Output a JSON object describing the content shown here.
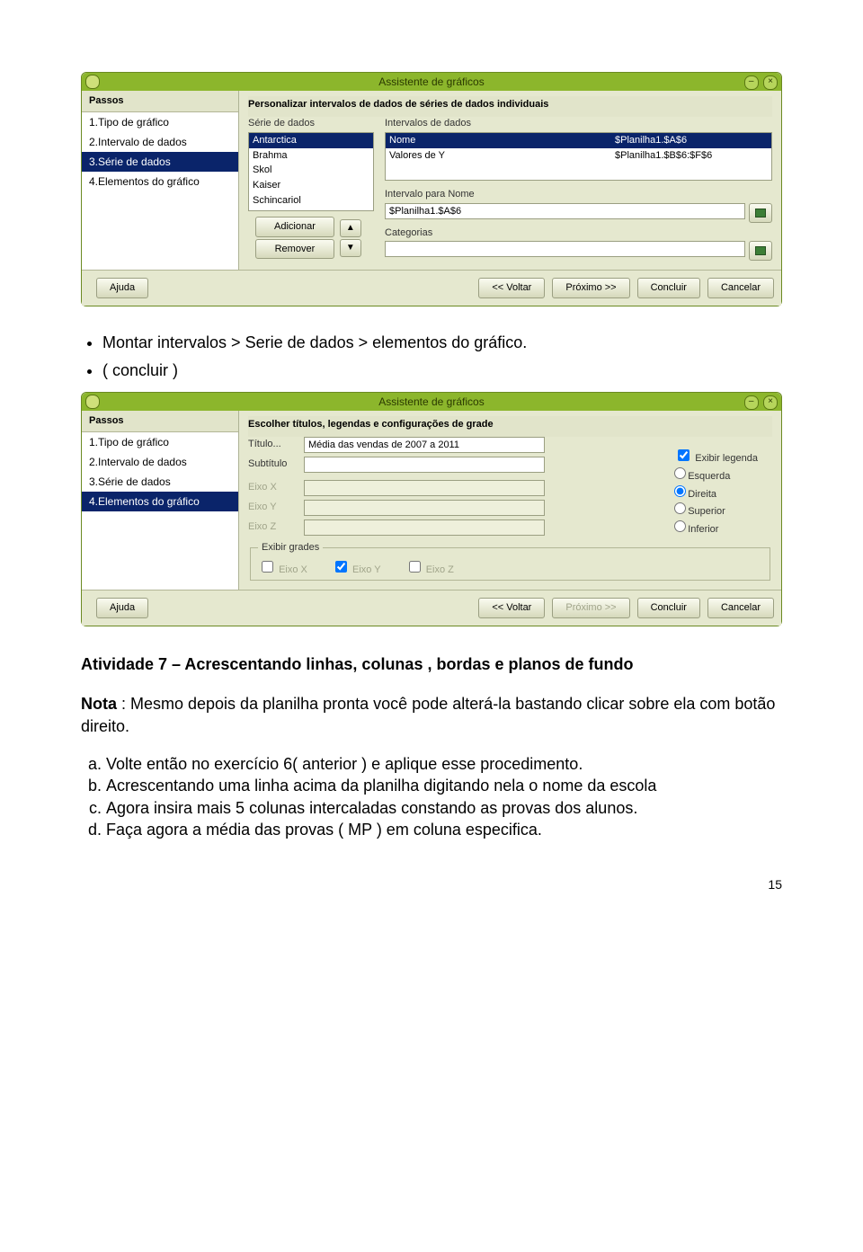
{
  "win_title": "Assistente de gráficos",
  "steps_heading": "Passos",
  "steps": {
    "s1": "1.Tipo de gráfico",
    "s2": "2.Intervalo de dados",
    "s3": "3.Série de dados",
    "s4": "4.Elementos do gráfico"
  },
  "win1": {
    "main_heading": "Personalizar intervalos de dados de séries de dados individuais",
    "series_label": "Série de dados",
    "ranges_label": "Intervalos de dados",
    "series": {
      "i0": "Antarctica",
      "i1": "Brahma",
      "i2": "Skol",
      "i3": "Kaiser",
      "i4": "Schincariol"
    },
    "ranges": {
      "name_k": "Nome",
      "name_v": "$Planilha1.$A$6",
      "y_k": "Valores de Y",
      "y_v": "$Planilha1.$B$6:$F$6"
    },
    "interval_name_label": "Intervalo para Nome",
    "interval_name_value": "$Planilha1.$A$6",
    "categories_label": "Categorias",
    "categories_value": "",
    "add_btn": "Adicionar",
    "remove_btn": "Remover"
  },
  "win2": {
    "main_heading": "Escolher títulos, legendas e configurações de grade",
    "title_label": "Título...",
    "title_value": "Média das vendas de 2007 a 2011",
    "subtitle_label": "Subtítulo",
    "eixo_x": "Eixo X",
    "eixo_y": "Eixo Y",
    "eixo_z": "Eixo Z",
    "show_legend": "Exibir legenda",
    "pos": {
      "left": "Esquerda",
      "right": "Direita",
      "top": "Superior",
      "bottom": "Inferior"
    },
    "grades_legend": "Exibir grades"
  },
  "footer": {
    "help": "Ajuda",
    "back": "<< Voltar",
    "next": "Próximo >>",
    "finish": "Concluir",
    "cancel": "Cancelar"
  },
  "bullets": {
    "b0": "Montar intervalos > Serie de dados > elementos do gráfico.",
    "b1": "( concluir )"
  },
  "activity_title": "Atividade 7 – Acrescentando linhas, colunas , bordas e planos de fundo",
  "nota_label": "Nota",
  "nota_text": " : Mesmo depois da planilha pronta você pode alterá-la bastando clicar sobre ela com botão direito.",
  "list": {
    "a": "Volte então no exercício 6( anterior )   e aplique esse procedimento.",
    "b": "Acrescentando uma linha acima da planilha digitando nela  o nome da escola",
    "c": "Agora insira    mais 5 colunas intercaladas constando as provas dos alunos.",
    "d": "Faça agora a média das provas ( MP ) em coluna especifica."
  },
  "page_number": "15"
}
